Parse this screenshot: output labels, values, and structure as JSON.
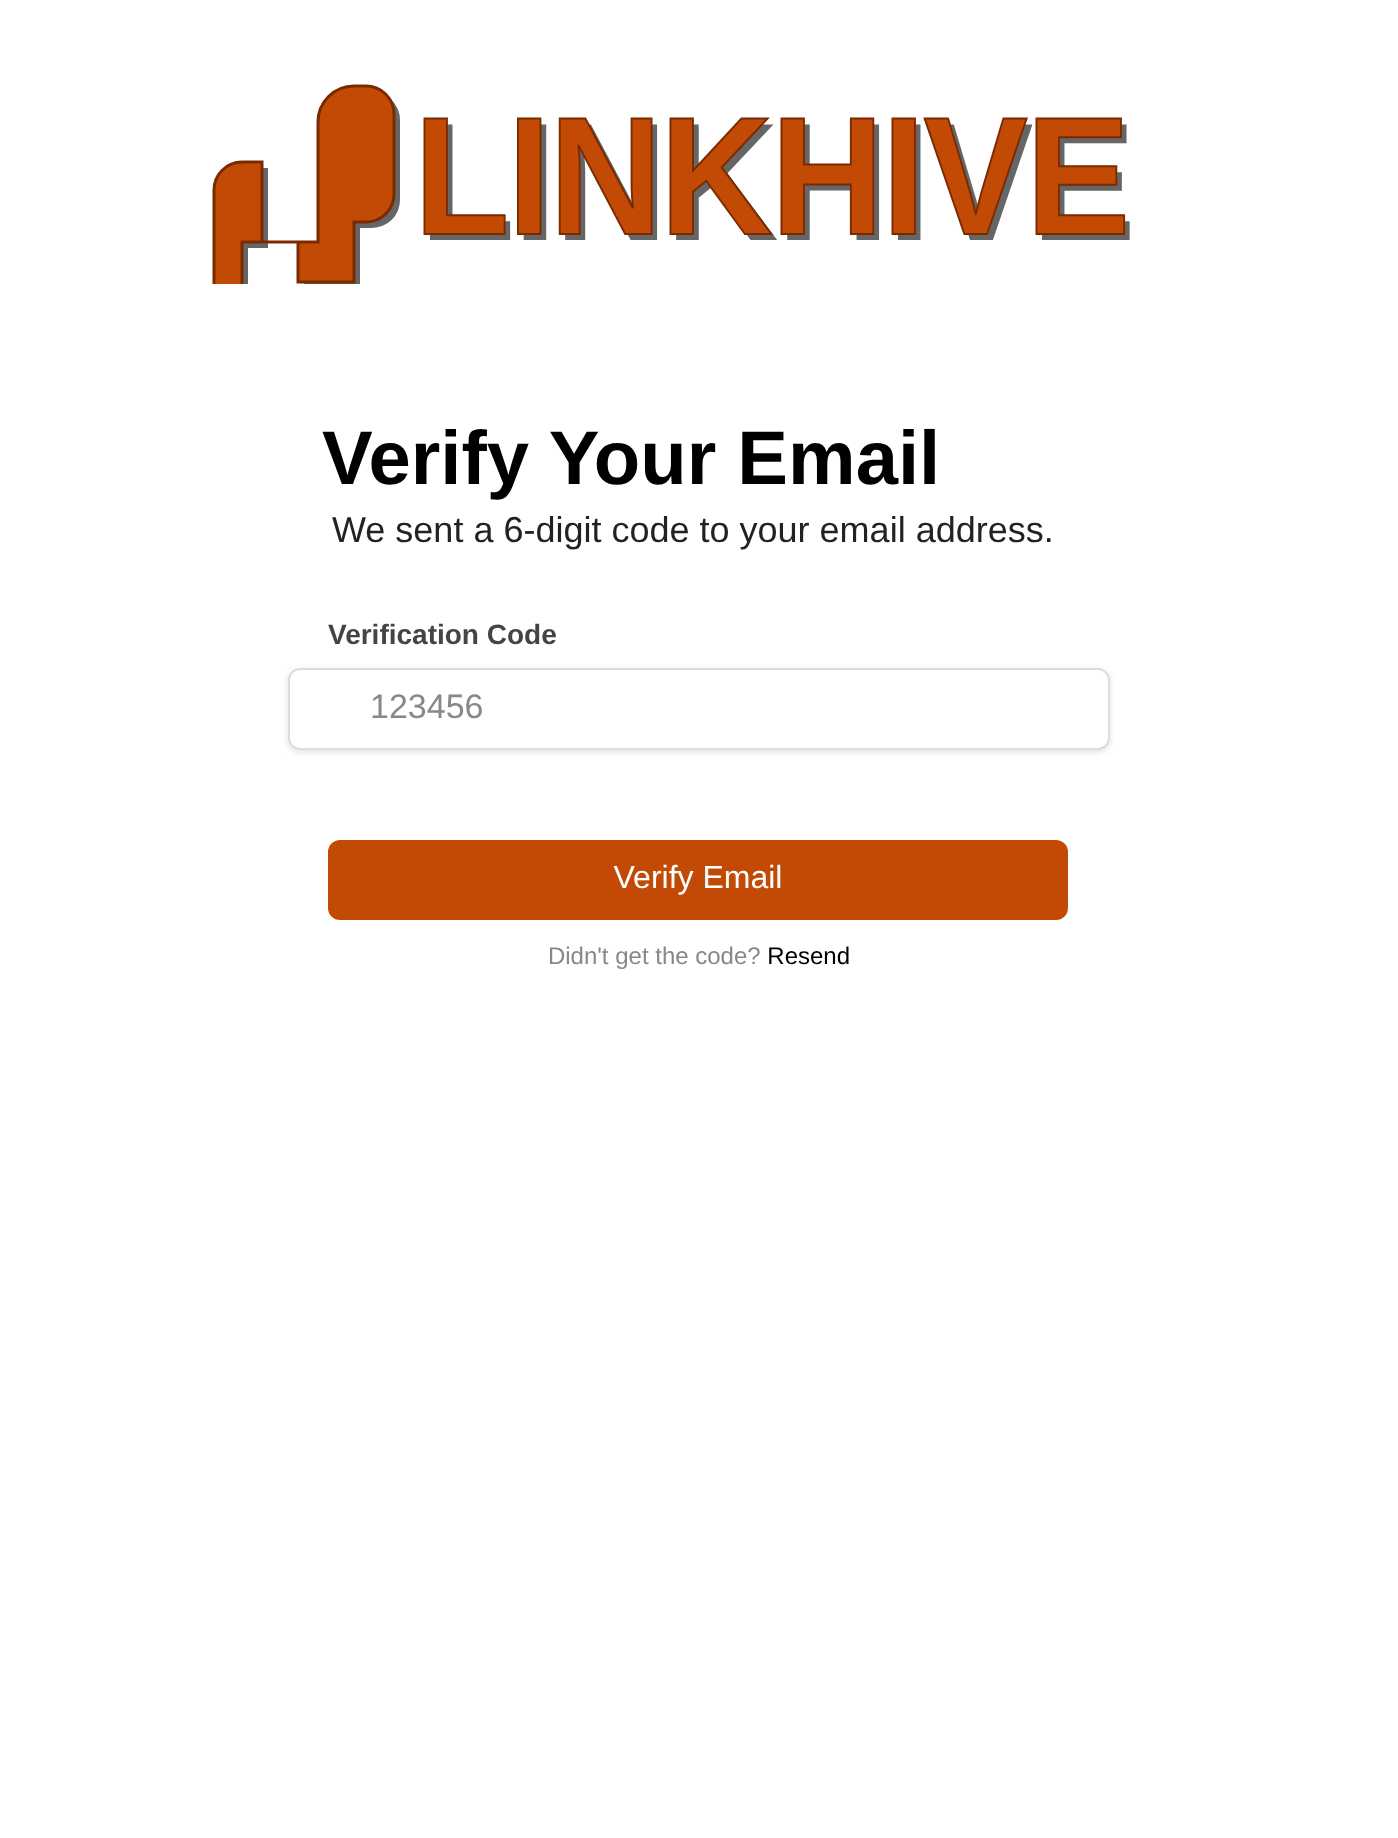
{
  "logo": {
    "wordmark": "LINKHIVE"
  },
  "title": "Verify Your Email",
  "subtitle": "We sent a 6-digit code to your email address.",
  "code_field": {
    "label": "Verification Code",
    "placeholder": "123456"
  },
  "submit_button": "Verify Email",
  "resend": {
    "prompt": "Didn't get the code?",
    "link": "Resend"
  }
}
